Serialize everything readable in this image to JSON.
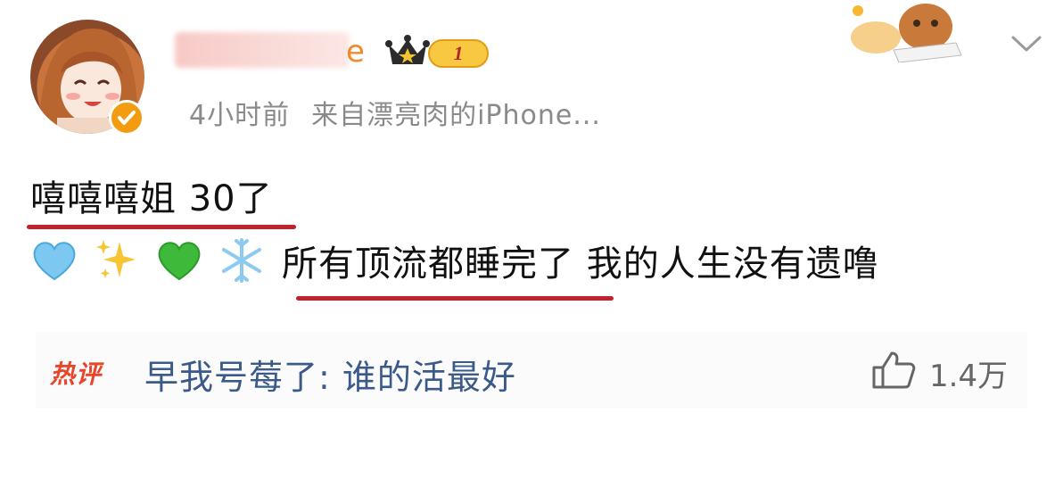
{
  "post": {
    "username_suffix": "e",
    "vip_level": "1",
    "time": "4小时前",
    "source": "来自漂亮肉的iPhone...",
    "line1": "嘻嘻嘻姐 30了",
    "line2_text": "所有顶流都睡完了 我的人生没有遗噜",
    "emojis": [
      "light-blue-heart-icon",
      "sparkles-icon",
      "green-heart-icon",
      "snowflake-icon"
    ]
  },
  "hot_comment": {
    "tag": "热评",
    "text": "早我号莓了: 谁的活最好",
    "likes": "1.4万"
  },
  "colors": {
    "accent_underline": "#c0232b",
    "meta_gray": "#8a8a8a",
    "comment_blue": "#3a5a8a",
    "hot_red": "#e8452b",
    "username_orange": "#f08a2a"
  }
}
